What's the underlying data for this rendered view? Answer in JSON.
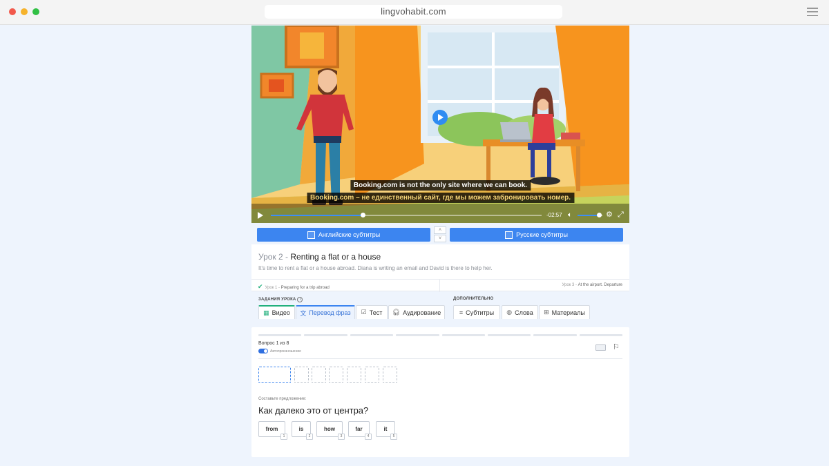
{
  "browser": {
    "url": "lingvohabit.com"
  },
  "video": {
    "subtitle_en": "Booking.com is not the only site where we can book.",
    "subtitle_ru": "Booking.com – не единственный сайт, где мы можем забронировать номер.",
    "time": "-02:57",
    "progress": 0.34,
    "volume": 0.85
  },
  "subtitle_toggles": {
    "english": "Английские субтитры",
    "russian": "Русские субтитры",
    "up": "˄",
    "down": "˅"
  },
  "lesson": {
    "prefix": "Урок 2 - ",
    "title": "Renting a flat or a house",
    "description": "It's time to rent a flat or a house abroad. Diana is writing an email and David is there to help her.",
    "prev_num": "Урок 1 -",
    "prev_title": "Preparing for a trip abroad",
    "next_num": "Урок 3 -",
    "next_title": "At the airport. Departure"
  },
  "tabs": {
    "tasks_label": "ЗАДАНИЯ УРОКА",
    "extra_label": "ДОПОЛНИТЕЛЬНО",
    "video": "Видео",
    "phrase": "Перевод фраз",
    "test": "Тест",
    "audio": "Аудирование",
    "subtitles": "Субтитры",
    "words": "Слова",
    "materials": "Материалы"
  },
  "exercise": {
    "question": "Вопрос 1 из 8",
    "autoplay": "Автопроизношение",
    "hint": "Составьте предложение:",
    "sentence": "Как далеко это от центра?",
    "words": [
      {
        "text": "from",
        "key": "1"
      },
      {
        "text": "is",
        "key": "2"
      },
      {
        "text": "how",
        "key": "3"
      },
      {
        "text": "far",
        "key": "4"
      },
      {
        "text": "it",
        "key": "5"
      }
    ]
  },
  "colors": {
    "accent": "#3c85f0",
    "success": "#22b07d",
    "background": "#eef4fd"
  }
}
